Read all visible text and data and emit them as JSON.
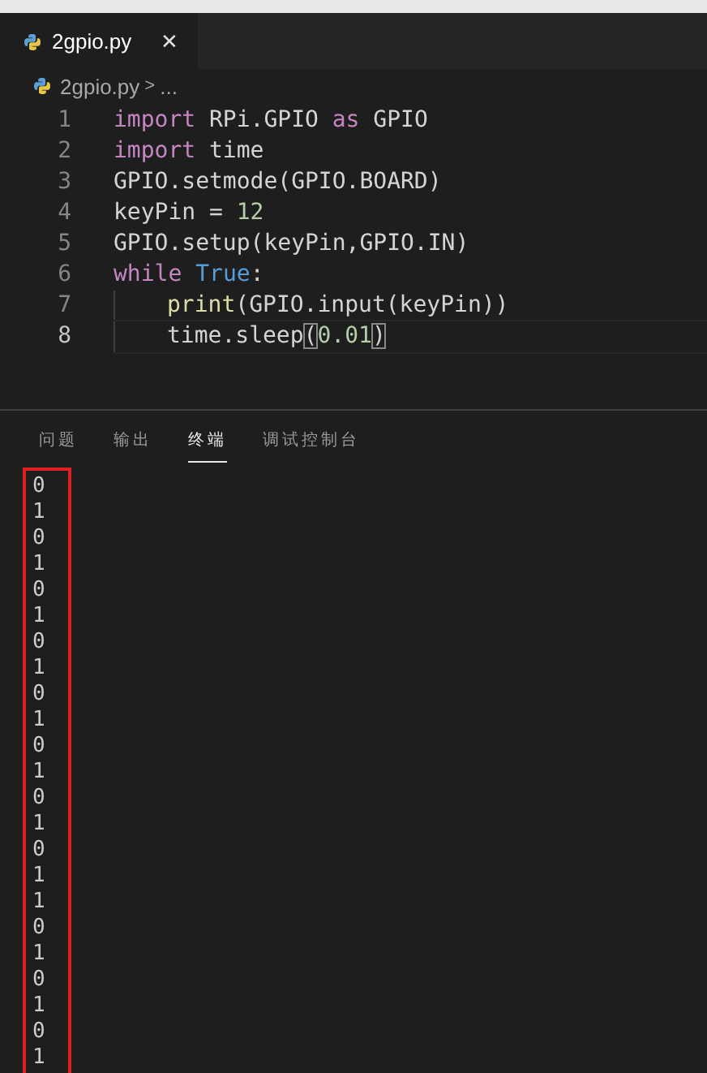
{
  "tabs": [
    {
      "label": "2gpio.py",
      "selected": true,
      "close": "✕"
    }
  ],
  "breadcrumb": {
    "file": "2gpio.py",
    "separator": ">",
    "rest": "..."
  },
  "code": [
    {
      "number": "1",
      "current": false,
      "tokens": [
        {
          "kind": "keyword",
          "text": "import"
        },
        {
          "kind": "plain",
          "text": " RPi.GPIO "
        },
        {
          "kind": "keyword",
          "text": "as"
        },
        {
          "kind": "plain",
          "text": " GPIO"
        }
      ]
    },
    {
      "number": "2",
      "current": false,
      "tokens": [
        {
          "kind": "keyword",
          "text": "import"
        },
        {
          "kind": "plain",
          "text": " time"
        }
      ]
    },
    {
      "number": "3",
      "current": false,
      "tokens": [
        {
          "kind": "plain",
          "text": "GPIO.setmode(GPIO.BOARD)"
        }
      ]
    },
    {
      "number": "4",
      "current": false,
      "tokens": [
        {
          "kind": "plain",
          "text": "keyPin = "
        },
        {
          "kind": "number",
          "text": "12"
        }
      ]
    },
    {
      "number": "5",
      "current": false,
      "tokens": [
        {
          "kind": "plain",
          "text": "GPIO.setup(keyPin,GPIO.IN)"
        }
      ]
    },
    {
      "number": "6",
      "current": false,
      "tokens": [
        {
          "kind": "keyword",
          "text": "while"
        },
        {
          "kind": "constant",
          "text": " True"
        },
        {
          "kind": "plain",
          "text": ":"
        }
      ],
      "children": [
        {
          "number": "7",
          "current": false,
          "tokens": [
            {
              "kind": "function",
              "text": "print"
            },
            {
              "kind": "plain",
              "text": "(GPIO.input(keyPin))"
            }
          ]
        },
        {
          "number": "8",
          "current": true,
          "tokens": [
            {
              "kind": "plain",
              "text": "time.sleep"
            },
            {
              "kind": "bracket-match",
              "text": "("
            },
            {
              "kind": "number",
              "text": "0.01"
            },
            {
              "kind": "bracket-match",
              "text": ")"
            }
          ]
        }
      ]
    }
  ],
  "panel_tabs": [
    {
      "label": "问题",
      "selected": false
    },
    {
      "label": "输出",
      "selected": false
    },
    {
      "label": "终端",
      "selected": true
    },
    {
      "label": "调试控制台",
      "selected": false
    }
  ],
  "terminal_output": [
    "0",
    "1",
    "0",
    "1",
    "0",
    "1",
    "0",
    "1",
    "0",
    "1",
    "0",
    "1",
    "0",
    "1",
    "0",
    "1",
    "1",
    "0",
    "1",
    "0",
    "1",
    "0",
    "1"
  ]
}
